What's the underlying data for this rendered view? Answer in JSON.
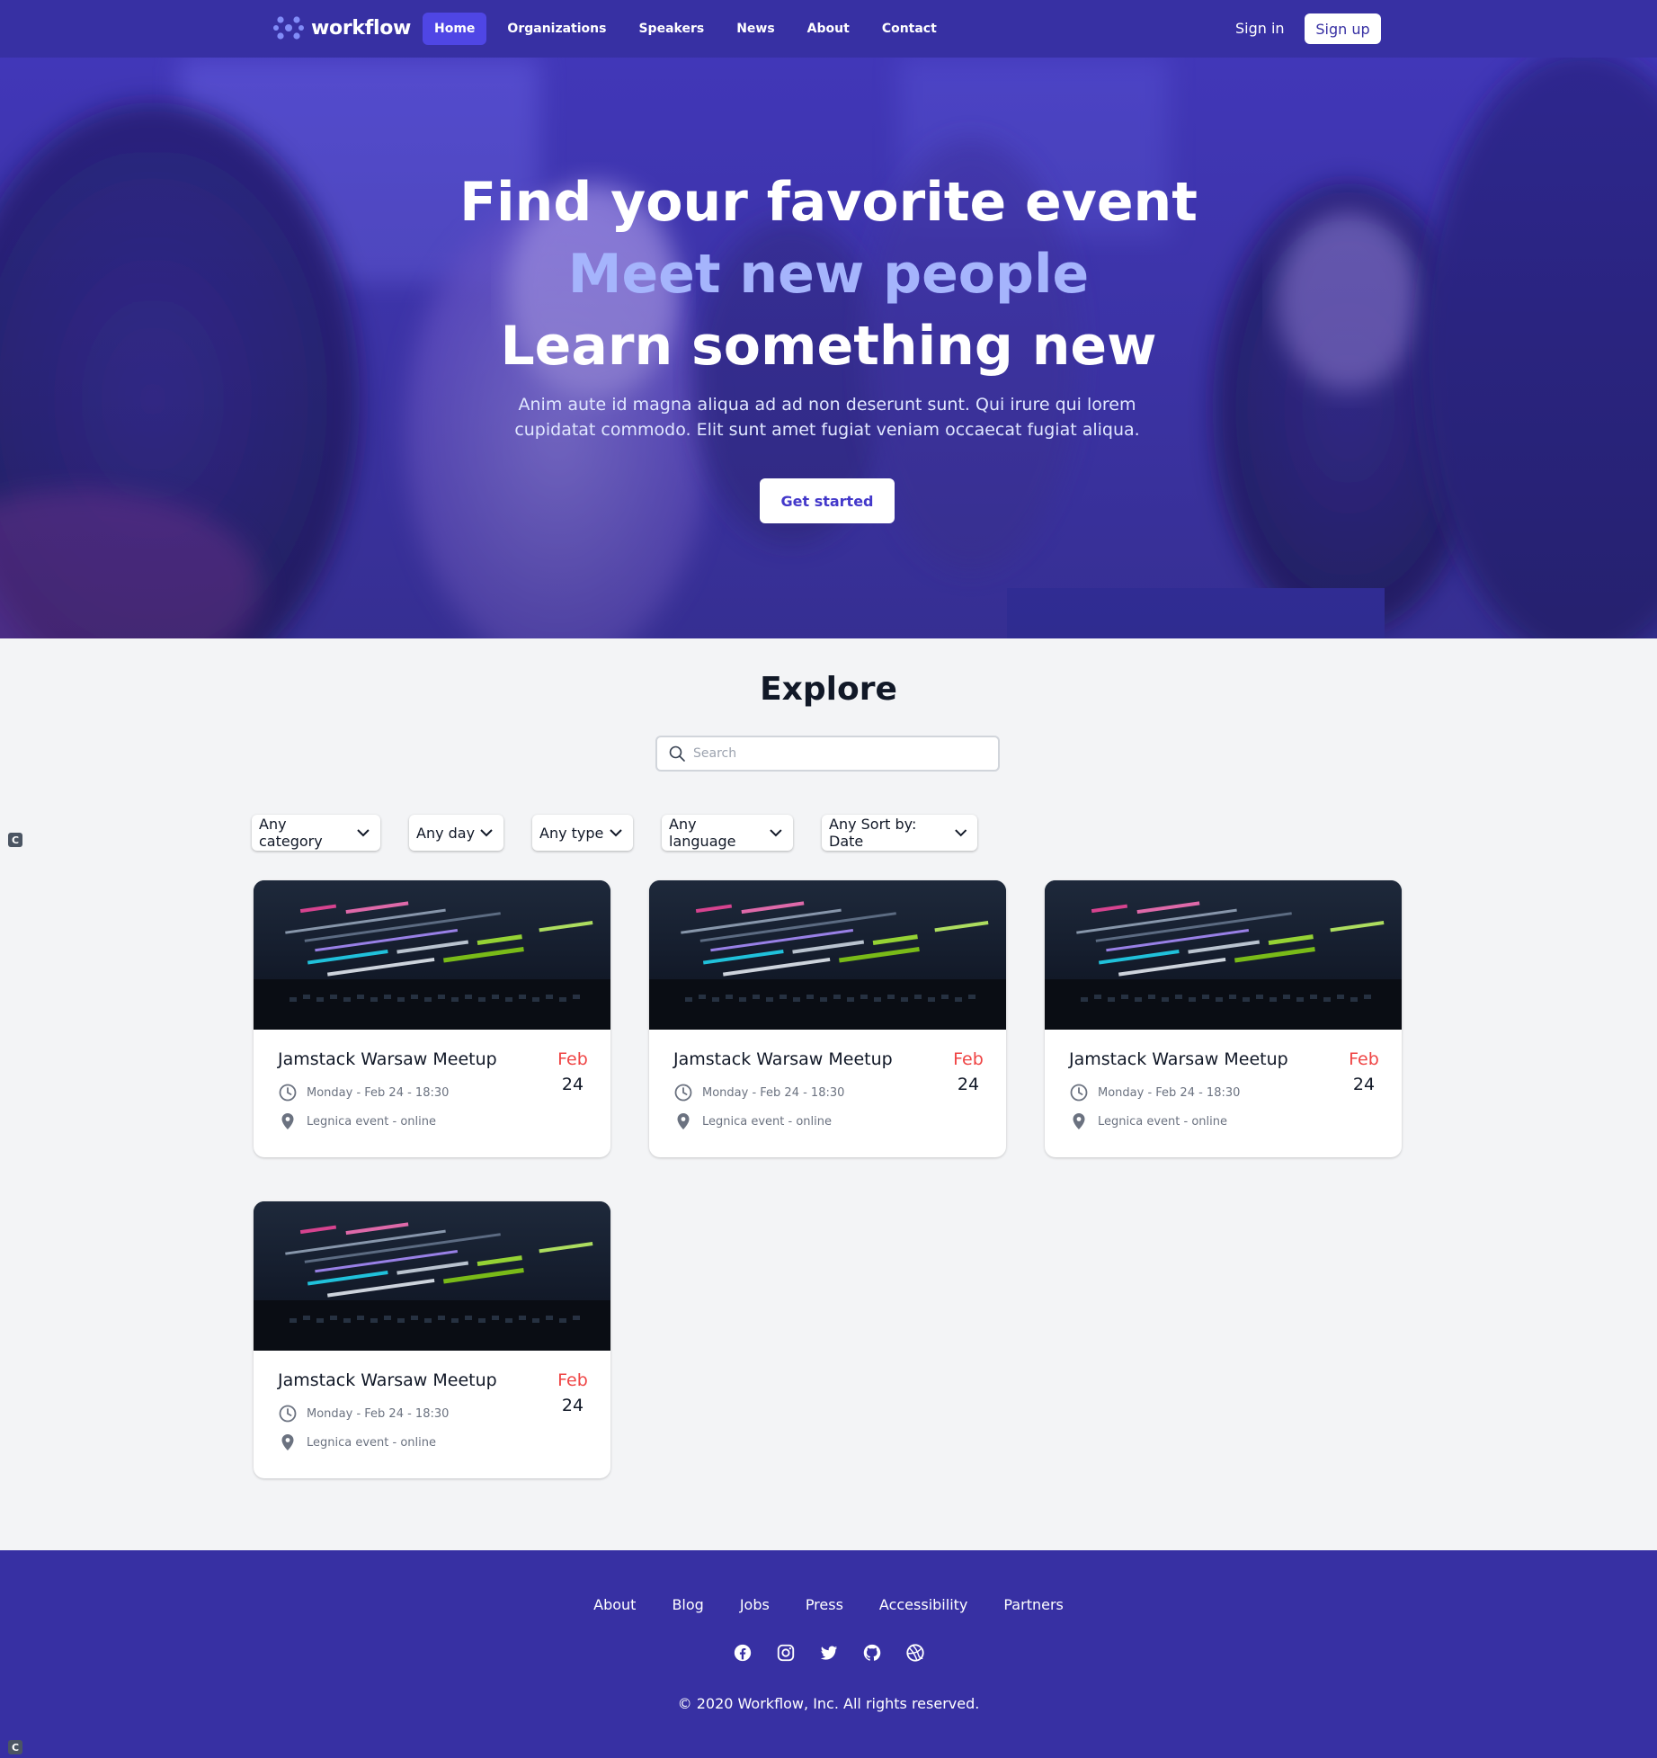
{
  "nav": {
    "brand": "workflow",
    "links": [
      "Home",
      "Organizations",
      "Speakers",
      "News",
      "About",
      "Contact"
    ],
    "sign_in": "Sign in",
    "sign_up": "Sign up"
  },
  "hero": {
    "line1": "Find your favorite event",
    "line2": "Meet new people",
    "line3": "Learn something new",
    "subtitle": "Anim aute id magna aliqua ad ad non deserunt sunt. Qui irure qui lorem cupidatat commodo. Elit sunt amet fugiat veniam occaecat fugiat aliqua.",
    "cta": "Get started"
  },
  "explore": {
    "title": "Explore",
    "search_placeholder": "Search",
    "filters": [
      "Any category",
      "Any day",
      "Any type",
      "Any language",
      "Any Sort by: Date"
    ]
  },
  "events": [
    {
      "title": "Jamstack Warsaw Meetup",
      "month": "Feb",
      "day": "24",
      "datetime": "Monday - Feb 24 - 18:30",
      "location": "Legnica event - online"
    },
    {
      "title": "Jamstack Warsaw Meetup",
      "month": "Feb",
      "day": "24",
      "datetime": "Monday - Feb 24 - 18:30",
      "location": "Legnica event - online"
    },
    {
      "title": "Jamstack Warsaw Meetup",
      "month": "Feb",
      "day": "24",
      "datetime": "Monday - Feb 24 - 18:30",
      "location": "Legnica event - online"
    },
    {
      "title": "Jamstack Warsaw Meetup",
      "month": "Feb",
      "day": "24",
      "datetime": "Monday - Feb 24 - 18:30",
      "location": "Legnica event - online"
    }
  ],
  "footer": {
    "links": [
      "About",
      "Blog",
      "Jobs",
      "Press",
      "Accessibility",
      "Partners"
    ],
    "socials": [
      "facebook-icon",
      "instagram-icon",
      "twitter-icon",
      "github-icon",
      "dribbble-icon"
    ],
    "copyright": "© 2020 Workflow, Inc. All rights reserved."
  },
  "colors": {
    "primary": "#3730a3",
    "accent": "#4f46e5",
    "hero_highlight": "#a5b4fc",
    "date_month": "#ef4444"
  }
}
